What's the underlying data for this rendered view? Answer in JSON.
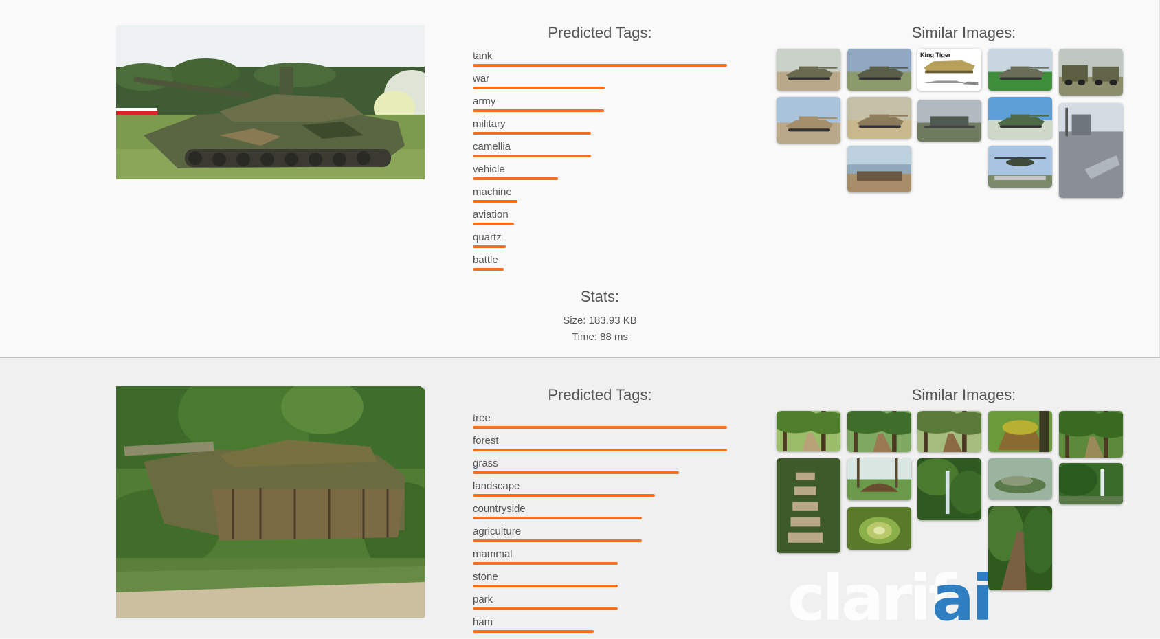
{
  "results": [
    {
      "image_alt": "Type 90 tank on display field",
      "predicted_tags_title": "Predicted Tags:",
      "similar_images_title": "Similar Images:",
      "tags": [
        {
          "label": "tank",
          "score": 1.0
        },
        {
          "label": "war",
          "score": 0.52
        },
        {
          "label": "army",
          "score": 0.515
        },
        {
          "label": "military",
          "score": 0.465
        },
        {
          "label": "camellia",
          "score": 0.465
        },
        {
          "label": "vehicle",
          "score": 0.335
        },
        {
          "label": "machine",
          "score": 0.175
        },
        {
          "label": "aviation",
          "score": 0.163
        },
        {
          "label": "quartz",
          "score": 0.13
        },
        {
          "label": "battle",
          "score": 0.122
        }
      ],
      "stats": {
        "title": "Stats:",
        "size": "Size: 183.93 KB",
        "time": "Time: 88 ms"
      },
      "similar_images": [
        {
          "subject": "desert tank"
        },
        {
          "subject": "tank on field"
        },
        {
          "subject": "king tiger diagram",
          "caption": "King Tiger"
        },
        {
          "subject": "tank on grass"
        },
        {
          "subject": "military trucks"
        },
        {
          "subject": "abrams tank"
        },
        {
          "subject": "desert tank crew"
        },
        {
          "subject": "monument"
        },
        {
          "subject": "tank on pedestal"
        },
        {
          "subject": "aircraft carrier"
        },
        {
          "subject": "fortification coast"
        },
        {
          "subject": "helicopter airfield"
        }
      ]
    },
    {
      "image_alt": "Camouflaged tank in forest",
      "predicted_tags_title": "Predicted Tags:",
      "similar_images_title": "Similar Images:",
      "tags": [
        {
          "label": "tree",
          "score": 1.0
        },
        {
          "label": "forest",
          "score": 1.0
        },
        {
          "label": "grass",
          "score": 0.81
        },
        {
          "label": "landscape",
          "score": 0.715
        },
        {
          "label": "countryside",
          "score": 0.665
        },
        {
          "label": "agriculture",
          "score": 0.665
        },
        {
          "label": "mammal",
          "score": 0.57
        },
        {
          "label": "stone",
          "score": 0.57
        },
        {
          "label": "park",
          "score": 0.57
        },
        {
          "label": "ham",
          "score": 0.475
        }
      ],
      "similar_images": [
        {
          "subject": "forest path arch"
        },
        {
          "subject": "forest trail"
        },
        {
          "subject": "forest clearing"
        },
        {
          "subject": "mossy stump"
        },
        {
          "subject": "fern forest"
        },
        {
          "subject": "stone steps"
        },
        {
          "subject": "mossy mound"
        },
        {
          "subject": "waterfall"
        },
        {
          "subject": "mossy rocks"
        },
        {
          "subject": "forest waterfall"
        },
        {
          "subject": "tree tunnel"
        },
        {
          "subject": "mossy trail"
        }
      ]
    }
  ],
  "branding": {
    "logo_text_1": "clarif",
    "logo_text_2": "ai"
  },
  "colors": {
    "tag_bar": "#f37021",
    "logo_blue": "#2f7ec1"
  }
}
